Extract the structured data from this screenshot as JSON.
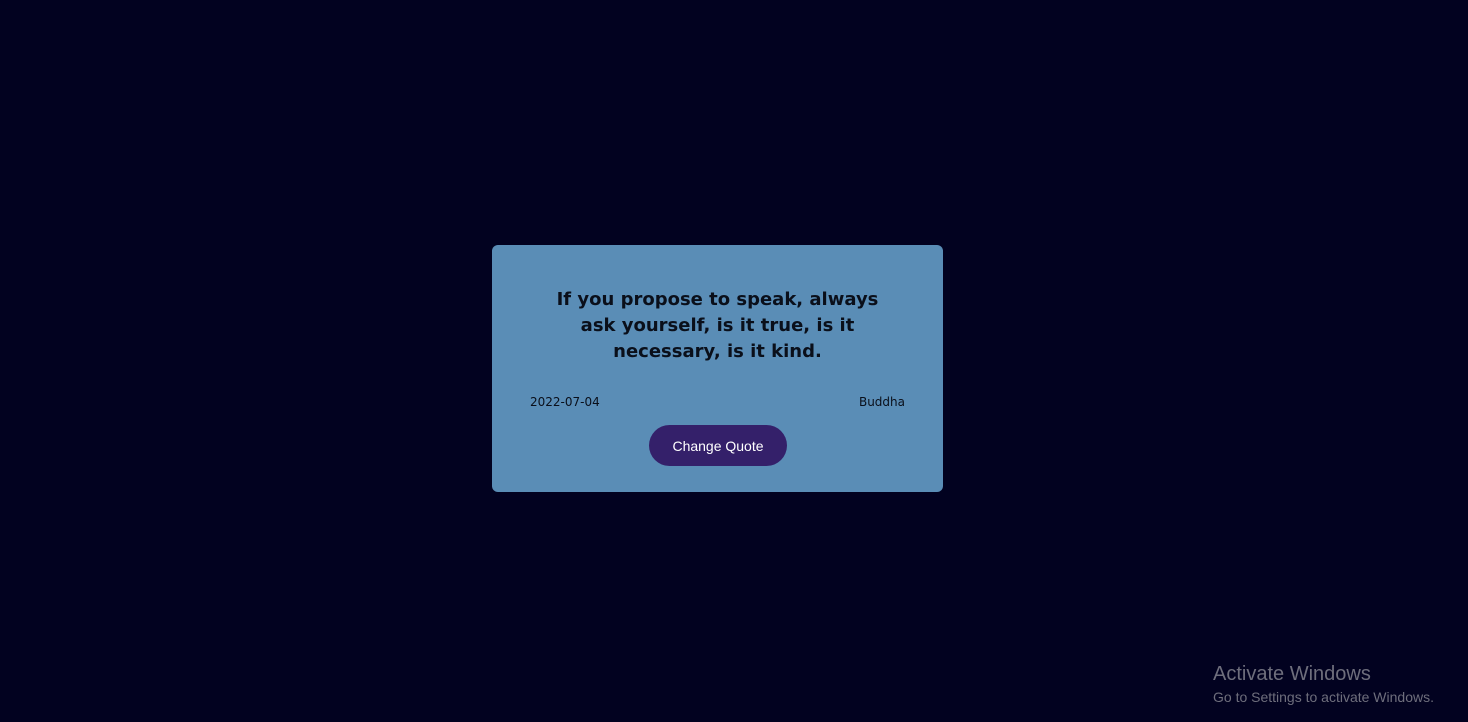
{
  "quote": {
    "text": "If you propose to speak, always ask yourself, is it true, is it necessary, is it kind.",
    "date": "2022-07-04",
    "author": "Buddha",
    "button_label": "Change Quote"
  },
  "watermark": {
    "title": "Activate Windows",
    "subtitle": "Go to Settings to activate Windows."
  },
  "colors": {
    "background": "#020220",
    "card": "#5a8db6",
    "button": "#34206a",
    "button_text": "#ffffff",
    "watermark_text": "#6e6e7c"
  }
}
